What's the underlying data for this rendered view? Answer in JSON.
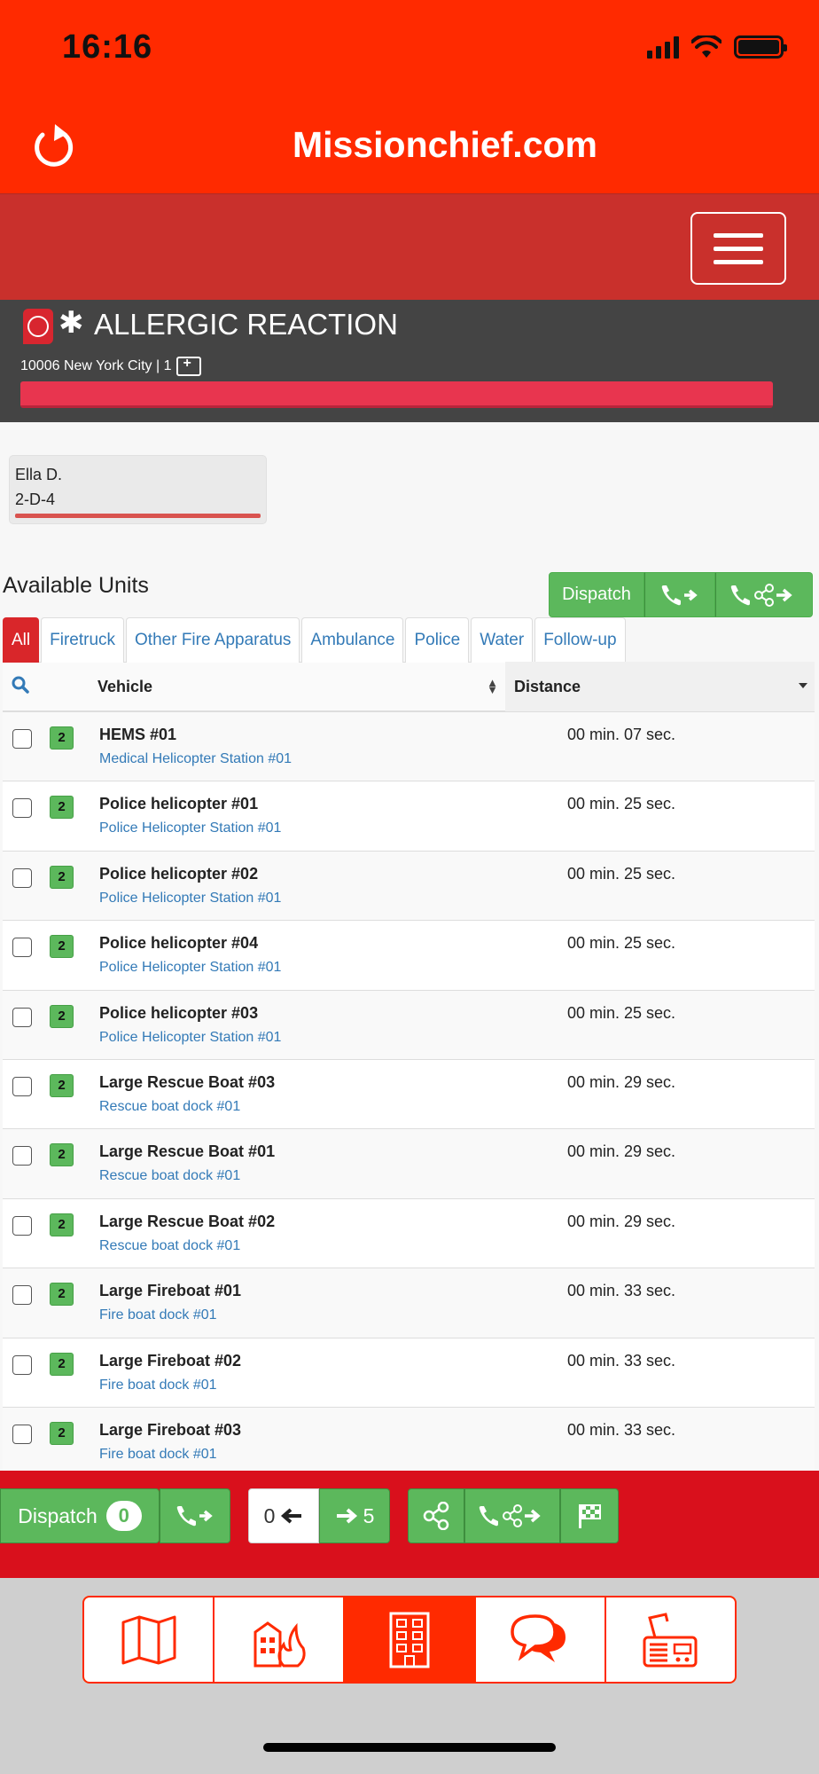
{
  "status_bar": {
    "time": "16:16"
  },
  "header": {
    "title": "Missionchief.com"
  },
  "mission": {
    "title": "ALLERGIC REACTION",
    "address": "10006 New York City | 1",
    "progress_percent": 100
  },
  "patient": {
    "name": "Ella D.",
    "code": "2-D-4"
  },
  "available_units": {
    "title": "Available Units",
    "dispatch_label": "Dispatch"
  },
  "tabs": [
    "All",
    "Firetruck",
    "Other Fire Apparatus",
    "Ambulance",
    "Police",
    "Water",
    "Follow-up"
  ],
  "table": {
    "headers": {
      "vehicle": "Vehicle",
      "distance": "Distance"
    },
    "rows": [
      {
        "status": "2",
        "name": "HEMS #01",
        "station": "Medical Helicopter Station #01",
        "distance": "00 min. 07 sec."
      },
      {
        "status": "2",
        "name": "Police helicopter #01",
        "station": "Police Helicopter Station #01",
        "distance": "00 min. 25 sec."
      },
      {
        "status": "2",
        "name": "Police helicopter #02",
        "station": "Police Helicopter Station #01",
        "distance": "00 min. 25 sec."
      },
      {
        "status": "2",
        "name": "Police helicopter #04",
        "station": "Police Helicopter Station #01",
        "distance": "00 min. 25 sec."
      },
      {
        "status": "2",
        "name": "Police helicopter #03",
        "station": "Police Helicopter Station #01",
        "distance": "00 min. 25 sec."
      },
      {
        "status": "2",
        "name": "Large Rescue Boat #03",
        "station": "Rescue boat dock #01",
        "distance": "00 min. 29 sec."
      },
      {
        "status": "2",
        "name": "Large Rescue Boat #01",
        "station": "Rescue boat dock #01",
        "distance": "00 min. 29 sec."
      },
      {
        "status": "2",
        "name": "Large Rescue Boat #02",
        "station": "Rescue boat dock #01",
        "distance": "00 min. 29 sec."
      },
      {
        "status": "2",
        "name": "Large Fireboat #01",
        "station": "Fire boat dock #01",
        "distance": "00 min. 33 sec."
      },
      {
        "status": "2",
        "name": "Large Fireboat #02",
        "station": "Fire boat dock #01",
        "distance": "00 min. 33 sec."
      },
      {
        "status": "2",
        "name": "Large Fireboat #03",
        "station": "Fire boat dock #01",
        "distance": "00 min. 33 sec."
      }
    ]
  },
  "action_bar": {
    "dispatch_label": "Dispatch",
    "dispatch_count": "0",
    "prev_count": "0",
    "next_count": "5"
  },
  "tabbar": {
    "items": [
      "map-icon",
      "fire-building-icon",
      "building-icon",
      "chat-icon",
      "radio-icon"
    ],
    "active_index": 2
  },
  "colors": {
    "header_red": "#ff2a00",
    "nav_red": "#c9302c",
    "action_red": "#d9101c",
    "green": "#5cb85c",
    "link_blue": "#337ab7",
    "mission_gray": "#444444"
  }
}
